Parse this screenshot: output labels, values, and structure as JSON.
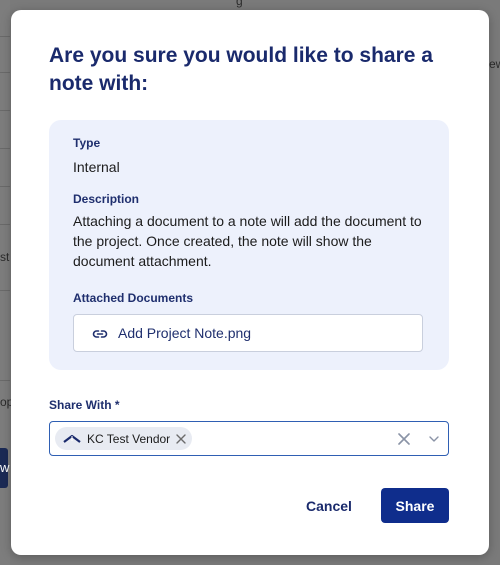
{
  "background": {
    "fragments": [
      "g",
      "st",
      "op",
      "w",
      "ew"
    ]
  },
  "modal": {
    "title": "Are you sure you would like to share a note with:",
    "type_label": "Type",
    "type_value": "Internal",
    "description_label": "Description",
    "description_value": "Attaching a document to a note will add the document to the project. Once created, the note will show the document attachment.",
    "attached_label": "Attached Documents",
    "attachments": [
      {
        "name": "Add Project Note.png",
        "icon": "link-icon"
      }
    ],
    "share_with_label": "Share With *",
    "selected": [
      {
        "label": "KC Test Vendor",
        "icon": "vendor-logo-icon"
      }
    ],
    "cancel_label": "Cancel",
    "share_label": "Share"
  },
  "colors": {
    "accent": "#0f2d8c",
    "title": "#1a2a6c",
    "panel_bg": "#edf1fc",
    "focus_border": "#2f5fb3"
  }
}
